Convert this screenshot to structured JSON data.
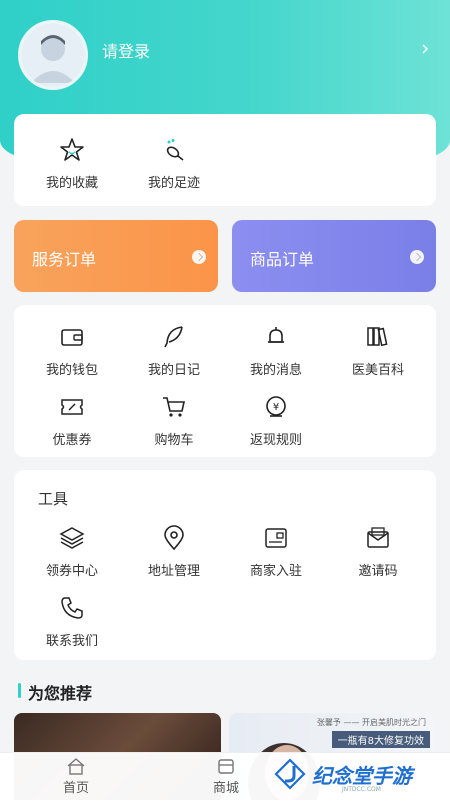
{
  "header": {
    "login_text": "请登录"
  },
  "quick": [
    {
      "label": "我的收藏",
      "icon": "star-icon"
    },
    {
      "label": "我的足迹",
      "icon": "footprint-icon"
    }
  ],
  "orders": [
    {
      "label": "服务订单",
      "color": "#f99d52"
    },
    {
      "label": "商品订单",
      "color": "#7f86ec"
    }
  ],
  "services": [
    {
      "label": "我的钱包",
      "icon": "wallet-icon"
    },
    {
      "label": "我的日记",
      "icon": "feather-icon"
    },
    {
      "label": "我的消息",
      "icon": "bell-icon"
    },
    {
      "label": "医美百科",
      "icon": "books-icon"
    },
    {
      "label": "优惠券",
      "icon": "coupon-icon"
    },
    {
      "label": "购物车",
      "icon": "cart-icon"
    },
    {
      "label": "返现规则",
      "icon": "cashback-icon"
    }
  ],
  "tools": {
    "title": "工具",
    "items": [
      {
        "label": "领券中心",
        "icon": "layers-icon"
      },
      {
        "label": "地址管理",
        "icon": "location-icon"
      },
      {
        "label": "商家入驻",
        "icon": "merchant-icon"
      },
      {
        "label": "邀请码",
        "icon": "envelope-icon"
      },
      {
        "label": "联系我们",
        "icon": "phone-icon"
      }
    ]
  },
  "recommend": {
    "title": "为您推荐",
    "card2_line1": "张馨予 —— 开启美肌时光之门",
    "card2_line2": "一瓶有8大修复功效"
  },
  "tabbar": [
    {
      "label": "首页",
      "icon": "home-icon"
    },
    {
      "label": "商城",
      "icon": "shop-icon"
    }
  ],
  "watermark": {
    "name": "纪念堂手游",
    "sub": "JNTDCC.COM"
  },
  "colors": {
    "accent": "#2fd0c8",
    "service_order": "#f99d52",
    "goods_order": "#7f86ec"
  }
}
